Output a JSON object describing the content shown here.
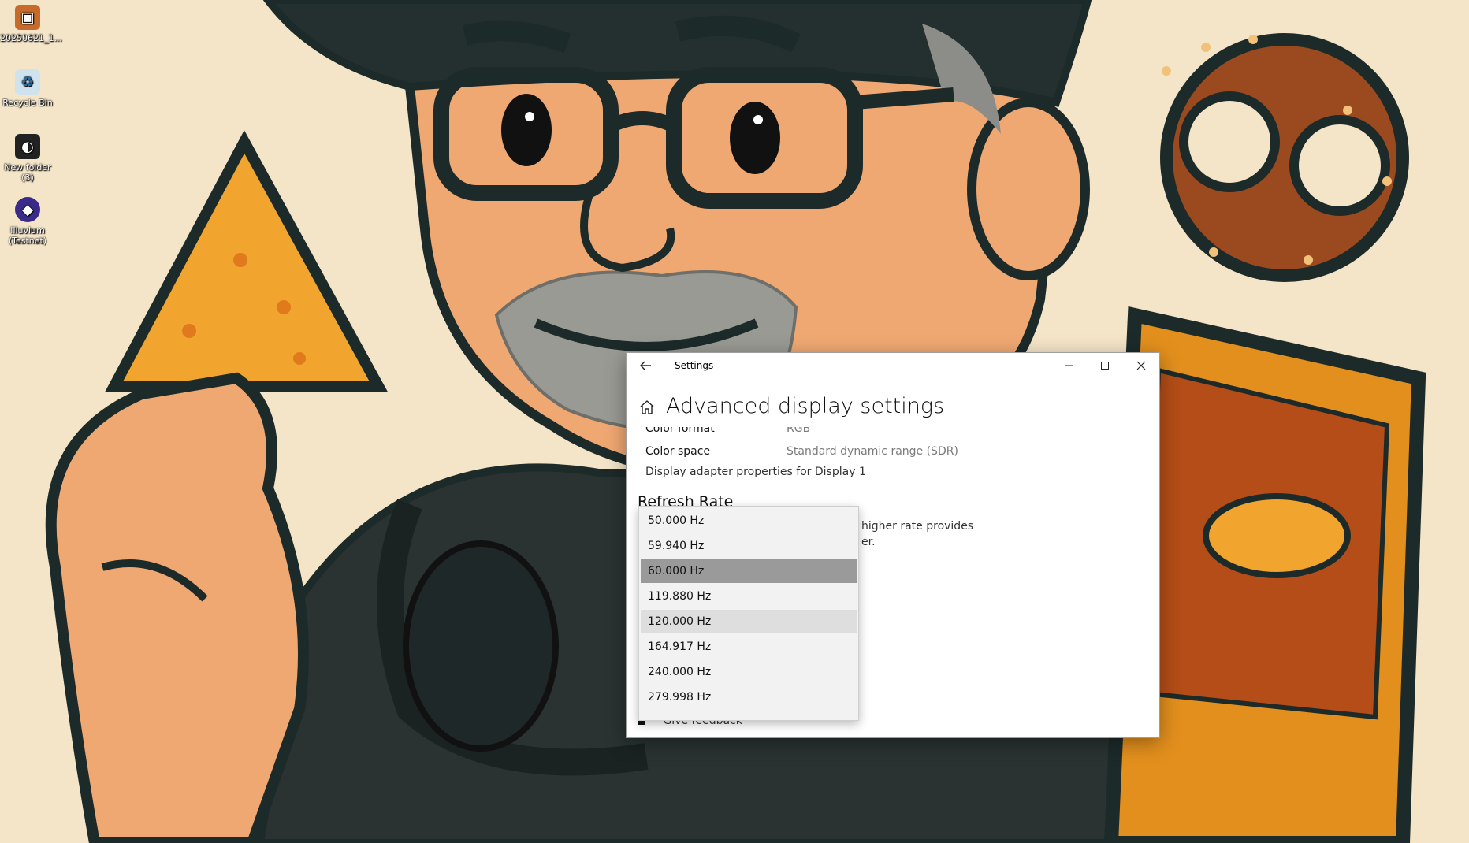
{
  "desktop": {
    "icons": [
      {
        "label": "20250621_1...",
        "icon": "image-file-icon"
      },
      {
        "label": "Recycle Bin",
        "icon": "recycle-bin-icon"
      },
      {
        "label": "New folder (3)",
        "icon": "folder-icon"
      },
      {
        "label": "Illuvium (Testnet)",
        "icon": "app-icon"
      }
    ]
  },
  "window": {
    "title": "Settings",
    "page_title": "Advanced display settings",
    "rows": [
      {
        "label": "Color format",
        "value": "RGB"
      },
      {
        "label": "Color space",
        "value": "Standard dynamic range (SDR)"
      }
    ],
    "adapter_link": "Display adapter properties for Display 1",
    "refresh_title": "Refresh Rate",
    "refresh_desc_line1": "higher rate provides",
    "refresh_desc_line2": "er.",
    "feedback_label": "Give feedback"
  },
  "dropdown": {
    "options": [
      "50.000 Hz",
      "59.940 Hz",
      "60.000 Hz",
      "119.880 Hz",
      "120.000 Hz",
      "164.917 Hz",
      "240.000 Hz",
      "279.998 Hz"
    ],
    "selected": "60.000 Hz",
    "hovered": "120.000 Hz"
  },
  "colors": {
    "wallpaper_bg": "#f4e4c8",
    "skin": "#f0a872",
    "dark_outline": "#1d2a2a",
    "beard": "#8c8c88",
    "chip": "#f1a42e",
    "pretzel": "#9a4a1e",
    "selected_option": "#9a9a9a"
  }
}
